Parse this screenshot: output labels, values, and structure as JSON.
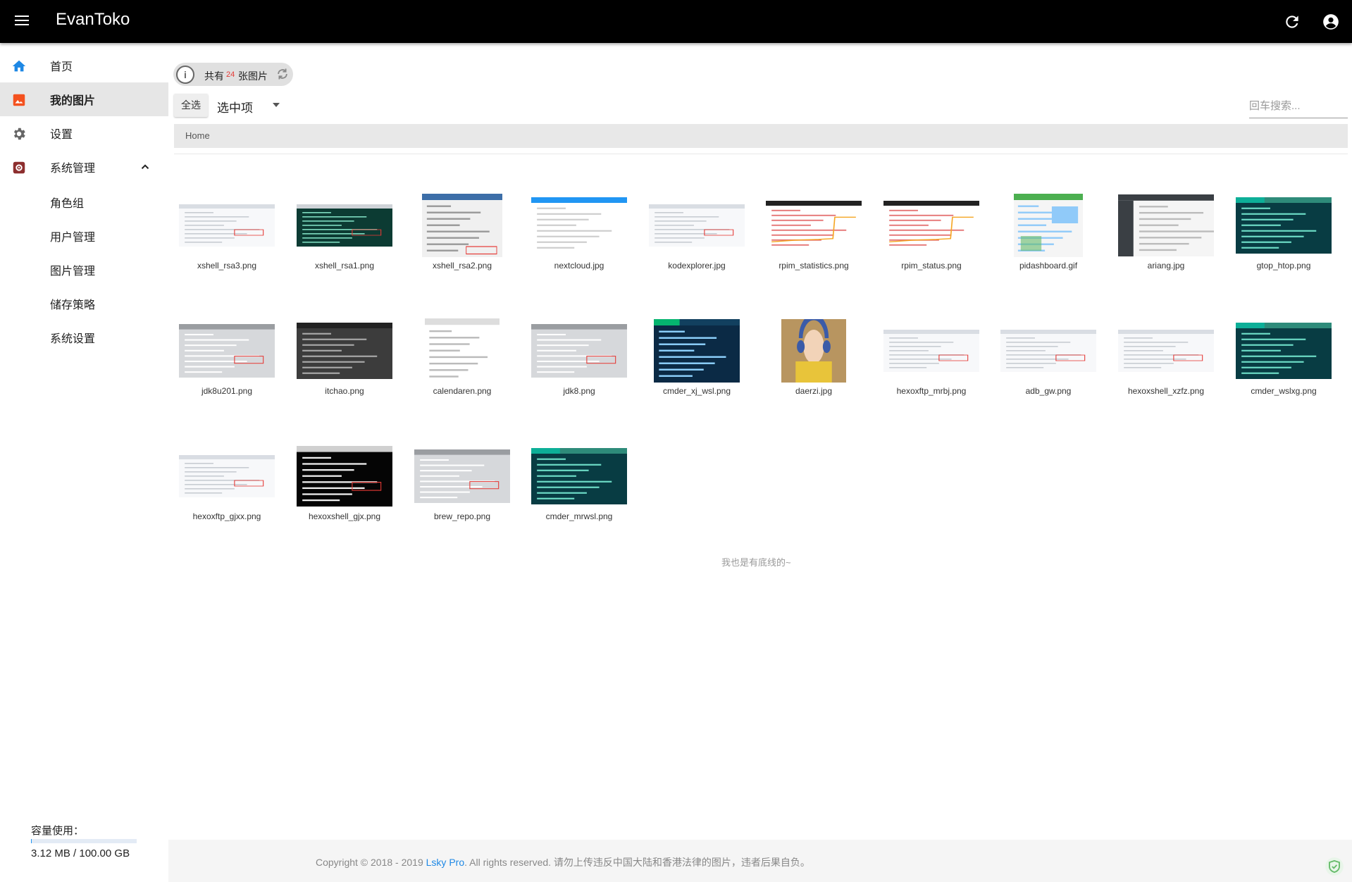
{
  "header": {
    "title": "EvanToko"
  },
  "sidebar": {
    "items": [
      {
        "label": "首页"
      },
      {
        "label": "我的图片"
      },
      {
        "label": "设置"
      },
      {
        "label": "系统管理"
      }
    ],
    "sub_items": [
      {
        "label": "角色组"
      },
      {
        "label": "用户管理"
      },
      {
        "label": "图片管理"
      },
      {
        "label": "储存策略"
      },
      {
        "label": "系统设置"
      }
    ],
    "usage_label": "容量使用：",
    "usage_text": "3.12 MB / 100.00 GB",
    "usage_fraction": 3.12e-05
  },
  "toolbar": {
    "count_prefix": "共有",
    "count": "24",
    "count_suffix": "张图片",
    "select_all": "全选",
    "selected_label": "选中项",
    "search_placeholder": "回车搜索..."
  },
  "breadcrumb": {
    "home": "Home"
  },
  "images": [
    {
      "name": "xshell_rsa3.png",
      "style": "light"
    },
    {
      "name": "xshell_rsa1.png",
      "style": "term"
    },
    {
      "name": "xshell_rsa2.png",
      "style": "dialog"
    },
    {
      "name": "nextcloud.jpg",
      "style": "blue"
    },
    {
      "name": "kodexplorer.jpg",
      "style": "light"
    },
    {
      "name": "rpim_statistics.png",
      "style": "chart"
    },
    {
      "name": "rpim_status.png",
      "style": "chart"
    },
    {
      "name": "pidashboard.gif",
      "style": "dash"
    },
    {
      "name": "ariang.jpg",
      "style": "darkside"
    },
    {
      "name": "gtop_htop.png",
      "style": "teal"
    },
    {
      "name": "jdk8u201.png",
      "style": "gray"
    },
    {
      "name": "itchao.png",
      "style": "darkgray"
    },
    {
      "name": "calendaren.png",
      "style": "table"
    },
    {
      "name": "jdk8.png",
      "style": "gray"
    },
    {
      "name": "cmder_xj_wsl.png",
      "style": "navy"
    },
    {
      "name": "daerzi.jpg",
      "style": "photo"
    },
    {
      "name": "hexoxftp_mrbj.png",
      "style": "light"
    },
    {
      "name": "adb_gw.png",
      "style": "light"
    },
    {
      "name": "hexoxshell_xzfz.png",
      "style": "light"
    },
    {
      "name": "cmder_wslxg.png",
      "style": "teal"
    },
    {
      "name": "hexoxftp_gjxx.png",
      "style": "light"
    },
    {
      "name": "hexoxshell_gjx.png",
      "style": "blackmenu"
    },
    {
      "name": "brew_repo.png",
      "style": "gray"
    },
    {
      "name": "cmder_mrwsl.png",
      "style": "teal"
    }
  ],
  "bottom_note": "我也是有底线的~",
  "footer": {
    "prefix": "Copyright © 2018 - 2019 ",
    "link": "Lsky Pro",
    "suffix": ". All rights reserved. 请勿上传违反中国大陆和香港法律的图片，违者后果自负。"
  }
}
